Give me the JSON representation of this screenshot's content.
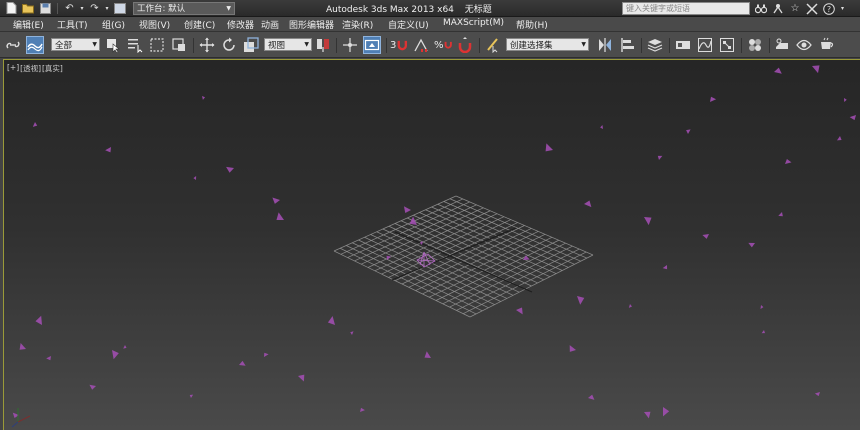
{
  "titlebar": {
    "workspace_label": "工作台: 默认",
    "app_name": "Autodesk 3ds Max  2013 x64",
    "file_name": "无标题",
    "search_placeholder": "键入关键字或短语",
    "quick_access_icons": [
      "new-icon",
      "open-icon",
      "save-icon",
      "undo-icon",
      "redo-icon",
      "project-icon"
    ],
    "right_icons": [
      "binoculars-icon",
      "signin-icon",
      "star-icon",
      "exchange-icon",
      "help-icon"
    ]
  },
  "menubar": {
    "items": [
      "编辑(E)",
      "工具(T)",
      "组(G)",
      "视图(V)",
      "创建(C)",
      "修改器",
      "动画",
      "图形编辑器",
      "渲染(R)",
      "自定义(U)",
      "MAXScript(M)",
      "帮助(H)"
    ]
  },
  "toolbar": {
    "selection_filter": "全部",
    "reference_coord": "视图",
    "named_selection": "创建选择集",
    "snap_labels": [
      "3",
      "%"
    ]
  },
  "viewport": {
    "labels": [
      "[+]",
      "[透视]",
      "[真实]"
    ],
    "grid_color": "#8c8c8c",
    "particle_color": "#a64fb6",
    "border_color": "#9a9a38"
  }
}
